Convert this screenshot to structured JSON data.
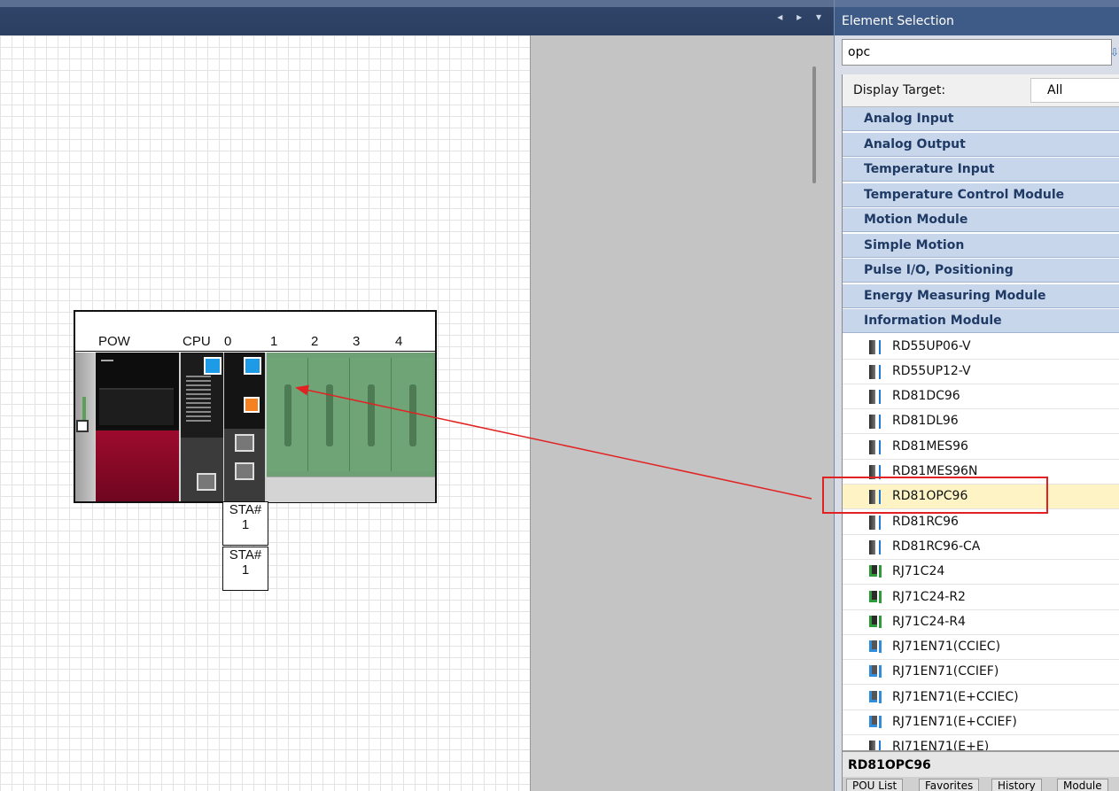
{
  "topbar": {
    "nav": "◂ ▸ ▾"
  },
  "rack": {
    "slots": [
      "POW",
      "CPU",
      "0",
      "1",
      "2",
      "3",
      "4"
    ]
  },
  "sta_labels": [
    {
      "line1": "STA#",
      "line2": "1"
    },
    {
      "line1": "STA#",
      "line2": "1"
    }
  ],
  "panel": {
    "title": "Element Selection",
    "search_value": "opc",
    "display_target_label": "Display Target:",
    "display_target_value": "All",
    "categories": [
      "Analog Input",
      "Analog Output",
      "Temperature Input",
      "Temperature Control Module",
      "Motion Module",
      "Simple Motion",
      "Pulse I/O, Positioning",
      "Energy Measuring Module",
      "Information Module"
    ],
    "items": [
      {
        "label": "RD55UP06-V",
        "icon": "grey"
      },
      {
        "label": "RD55UP12-V",
        "icon": "grey"
      },
      {
        "label": "RD81DC96",
        "icon": "grey"
      },
      {
        "label": "RD81DL96",
        "icon": "grey"
      },
      {
        "label": "RD81MES96",
        "icon": "grey"
      },
      {
        "label": "RD81MES96N",
        "icon": "grey"
      },
      {
        "label": "RD81OPC96",
        "icon": "grey"
      },
      {
        "label": "RD81RC96",
        "icon": "grey"
      },
      {
        "label": "RD81RC96-CA",
        "icon": "grey"
      },
      {
        "label": "RJ71C24",
        "icon": "green"
      },
      {
        "label": "RJ71C24-R2",
        "icon": "green"
      },
      {
        "label": "RJ71C24-R4",
        "icon": "green"
      },
      {
        "label": "RJ71EN71(CCIEC)",
        "icon": "blue"
      },
      {
        "label": "RJ71EN71(CCIEF)",
        "icon": "blue"
      },
      {
        "label": "RJ71EN71(E+CCIEC)",
        "icon": "blue"
      },
      {
        "label": "RJ71EN71(E+CCIEF)",
        "icon": "blue"
      },
      {
        "label": "RJ71EN71(E+E)",
        "icon": "grey"
      }
    ],
    "selected_item": "RD81OPC96",
    "bottom_tabs": [
      "POU List",
      "Favorites",
      "History",
      "Module"
    ]
  },
  "colors": {
    "highlight": "#e22222",
    "selected_row": "#fdf3c4",
    "category_bg": "#c7d6ea"
  }
}
